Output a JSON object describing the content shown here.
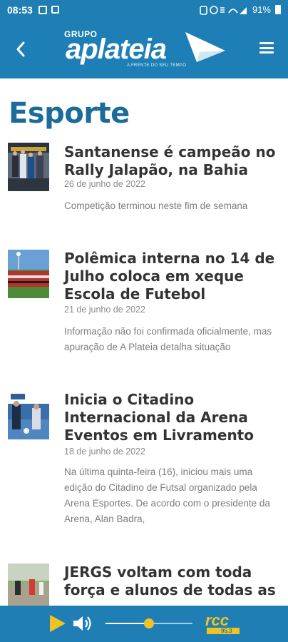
{
  "status_bar": {
    "time": "08:53",
    "battery": "91%"
  },
  "header": {
    "logo_group": "GRUPO",
    "logo_name": "aplateia",
    "logo_tagline": "A FRENTE DO SEU TEMPO",
    "back_icon": "chevron-left-icon",
    "menu_icon": "hamburger-menu-icon"
  },
  "page": {
    "title": "Esporte"
  },
  "articles": [
    {
      "title": "Santanense é campeão no Rally Jalapão, na Bahia",
      "date": "26 de junho de 2022",
      "summary": "Competição terminou neste fim de semana"
    },
    {
      "title": "Polêmica interna no 14 de Julho coloca em xeque Escola de Futebol",
      "date": "21 de junho de 2022",
      "summary": "Informação não foi confirmada oficialmente, mas apuração de A Plateia detalha situação"
    },
    {
      "title": "Inicia o Citadino Internacional da Arena Eventos em Livramento",
      "date": "18 de junho de 2022",
      "summary": "Na última quinta-feira (16), iniciou mais uma edição do Citadino de Futsal organizado pela Arena Esportes. De acordo com o presidente da Arena, Alan Badra,"
    },
    {
      "title": "JERGS voltam com toda força e alunos de todas as",
      "date": "",
      "summary": ""
    }
  ],
  "player": {
    "volume_level": 0.5,
    "station_logo": "rcc",
    "station_freq": "95.3"
  },
  "colors": {
    "brand_blue": "#1f7fb5",
    "title_blue": "#1b6c9b",
    "accent_yellow": "#f2c21f"
  }
}
